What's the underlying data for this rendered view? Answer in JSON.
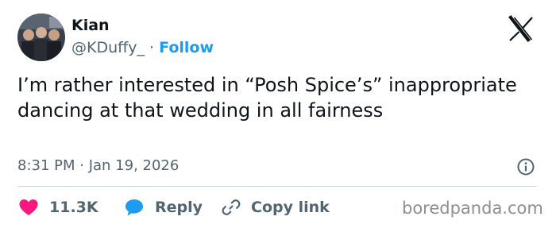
{
  "author": {
    "display_name": "Kian",
    "handle": "@KDuffy_",
    "separator": "·",
    "follow_label": "Follow"
  },
  "tweet": {
    "text": "I’m rather interested in “Posh Spice’s” inappropriate dancing at that wedding in all fairness",
    "timestamp": "8:31 PM · Jan 19, 2026"
  },
  "actions": {
    "like_count": "11.3K",
    "reply_label": "Reply",
    "copy_link_label": "Copy link"
  },
  "watermark": "boredpanda.com",
  "icons": {
    "logo": "x-logo-icon",
    "info": "info-icon",
    "like": "heart-icon",
    "reply": "speech-bubble-icon",
    "copy": "link-icon"
  },
  "colors": {
    "text": "#0f1419",
    "secondary": "#536471",
    "accent": "#1d9bf0",
    "like": "#f91880",
    "divider": "#cfd9de",
    "watermark": "#8a8f94"
  }
}
